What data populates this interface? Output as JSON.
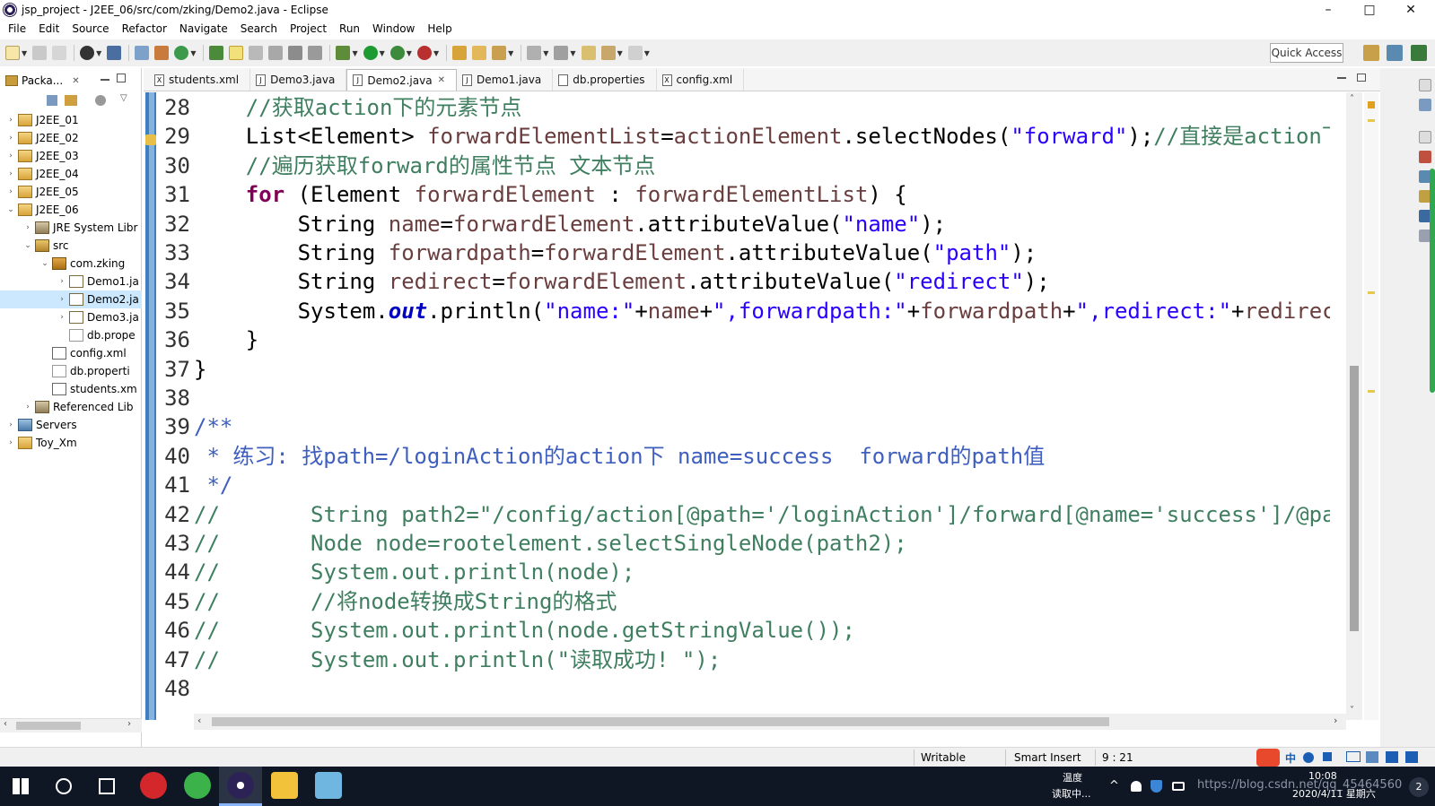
{
  "window": {
    "title": "jsp_project - J2EE_06/src/com/zking/Demo2.java - Eclipse",
    "minimize": "–",
    "maximize": "□",
    "close": "✕"
  },
  "menu": [
    "File",
    "Edit",
    "Source",
    "Refactor",
    "Navigate",
    "Search",
    "Project",
    "Run",
    "Window",
    "Help"
  ],
  "toolbar": {
    "quick_access": "Quick Access"
  },
  "explorer": {
    "tab_label": "Packa...",
    "tab_close": "✕",
    "tree": [
      {
        "label": "J2EE_01",
        "twisty": "›",
        "icon": "project",
        "indent": 0
      },
      {
        "label": "J2EE_02",
        "twisty": "›",
        "icon": "project",
        "indent": 0
      },
      {
        "label": "J2EE_03",
        "twisty": "›",
        "icon": "project",
        "indent": 0
      },
      {
        "label": "J2EE_04",
        "twisty": "›",
        "icon": "project",
        "indent": 0
      },
      {
        "label": "J2EE_05",
        "twisty": "›",
        "icon": "project",
        "indent": 0
      },
      {
        "label": "J2EE_06",
        "twisty": "⌄",
        "icon": "project",
        "indent": 0
      },
      {
        "label": "JRE System Libr",
        "twisty": "›",
        "icon": "library",
        "indent": 1
      },
      {
        "label": "src",
        "twisty": "⌄",
        "icon": "source-folder",
        "indent": 1
      },
      {
        "label": "com.zking",
        "twisty": "⌄",
        "icon": "package",
        "indent": 2
      },
      {
        "label": "Demo1.ja",
        "twisty": "›",
        "icon": "java-file",
        "indent": 3
      },
      {
        "label": "Demo2.ja",
        "twisty": "›",
        "icon": "java-file",
        "indent": 3,
        "selected": true
      },
      {
        "label": "Demo3.ja",
        "twisty": "›",
        "icon": "java-file",
        "indent": 3
      },
      {
        "label": "db.prope",
        "twisty": "",
        "icon": "file",
        "indent": 3
      },
      {
        "label": "config.xml",
        "twisty": "",
        "icon": "xml-file",
        "indent": 2
      },
      {
        "label": "db.properti",
        "twisty": "",
        "icon": "file",
        "indent": 2
      },
      {
        "label": "students.xm",
        "twisty": "",
        "icon": "xml-file",
        "indent": 2
      },
      {
        "label": "Referenced Lib",
        "twisty": "›",
        "icon": "library",
        "indent": 1
      },
      {
        "label": "Servers",
        "twisty": "›",
        "icon": "server",
        "indent": 0
      },
      {
        "label": "Toy_Xm",
        "twisty": "›",
        "icon": "project",
        "indent": 0
      }
    ]
  },
  "editor": {
    "tabs": [
      {
        "label": "students.xml",
        "icon": "X",
        "active": false
      },
      {
        "label": "Demo3.java",
        "icon": "J",
        "active": false
      },
      {
        "label": "Demo2.java",
        "icon": "J",
        "active": true,
        "close": "✕"
      },
      {
        "label": "Demo1.java",
        "icon": "J",
        "active": false
      },
      {
        "label": "db.properties",
        "icon": "",
        "active": false
      },
      {
        "label": "config.xml",
        "icon": "X",
        "active": false
      }
    ],
    "lines": [
      {
        "no": "28",
        "tokens": [
          [
            "cm",
            "    //获取action下的元素节点"
          ]
        ]
      },
      {
        "no": "29",
        "tokens": [
          [
            "",
            "    List<Element> "
          ],
          [
            "var",
            "forwardElementList"
          ],
          [
            "",
            "="
          ],
          [
            "var",
            "actionElement"
          ],
          [
            "",
            ".selectNodes("
          ],
          [
            "st",
            "\"forward\""
          ],
          [
            "",
            ");"
          ],
          [
            "cm",
            "//直接是action下"
          ]
        ]
      },
      {
        "no": "30",
        "tokens": [
          [
            "cm",
            "    //遍历获取forward的属性节点 文本节点"
          ]
        ]
      },
      {
        "no": "31",
        "tokens": [
          [
            "kw",
            "    for"
          ],
          [
            "",
            " (Element "
          ],
          [
            "var",
            "forwardElement"
          ],
          [
            "",
            " : "
          ],
          [
            "var",
            "forwardElementList"
          ],
          [
            "",
            ") {"
          ]
        ]
      },
      {
        "no": "32",
        "tokens": [
          [
            "",
            "        String "
          ],
          [
            "var",
            "name"
          ],
          [
            "",
            "="
          ],
          [
            "var",
            "forwardElement"
          ],
          [
            "",
            ".attributeValue("
          ],
          [
            "st",
            "\"name\""
          ],
          [
            "",
            ");"
          ]
        ]
      },
      {
        "no": "33",
        "tokens": [
          [
            "",
            "        String "
          ],
          [
            "var",
            "forwardpath"
          ],
          [
            "",
            "="
          ],
          [
            "var",
            "forwardElement"
          ],
          [
            "",
            ".attributeValue("
          ],
          [
            "st",
            "\"path\""
          ],
          [
            "",
            ");"
          ]
        ]
      },
      {
        "no": "34",
        "tokens": [
          [
            "",
            "        String "
          ],
          [
            "var",
            "redirect"
          ],
          [
            "",
            "="
          ],
          [
            "var",
            "forwardElement"
          ],
          [
            "",
            ".attributeValue("
          ],
          [
            "st",
            "\"redirect\""
          ],
          [
            "",
            ");"
          ]
        ]
      },
      {
        "no": "35",
        "tokens": [
          [
            "",
            "        System."
          ],
          [
            "fld",
            "out"
          ],
          [
            "",
            ".println("
          ],
          [
            "st",
            "\"name:\""
          ],
          [
            "",
            "+"
          ],
          [
            "var",
            "name"
          ],
          [
            "",
            "+"
          ],
          [
            "st",
            "\",forwardpath:\""
          ],
          [
            "",
            "+"
          ],
          [
            "var",
            "forwardpath"
          ],
          [
            "",
            "+"
          ],
          [
            "st",
            "\",redirect:\""
          ],
          [
            "",
            "+"
          ],
          [
            "var",
            "redirect"
          ]
        ]
      },
      {
        "no": "36",
        "tokens": [
          [
            "",
            "    }"
          ]
        ]
      },
      {
        "no": "37",
        "tokens": [
          [
            "",
            "}"
          ]
        ]
      },
      {
        "no": "38",
        "tokens": [
          [
            "",
            ""
          ]
        ]
      },
      {
        "no": "39",
        "tokens": [
          [
            "jd",
            "/**"
          ]
        ]
      },
      {
        "no": "40",
        "tokens": [
          [
            "jd",
            " * 练习: 找path=/loginAction的action下 name=success  forward的path值"
          ]
        ]
      },
      {
        "no": "41",
        "tokens": [
          [
            "jd",
            " */"
          ]
        ]
      },
      {
        "no": "42",
        "tokens": [
          [
            "cm",
            "//       String path2=\"/config/action[@path='/loginAction']/forward[@name='success']/@pa"
          ]
        ]
      },
      {
        "no": "43",
        "tokens": [
          [
            "cm",
            "//       Node node=rootelement.selectSingleNode(path2);"
          ]
        ]
      },
      {
        "no": "44",
        "tokens": [
          [
            "cm",
            "//       System.out.println(node);"
          ]
        ]
      },
      {
        "no": "45",
        "tokens": [
          [
            "cm",
            "//       //将node转换成String的格式"
          ]
        ]
      },
      {
        "no": "46",
        "tokens": [
          [
            "cm",
            "//       System.out.println(node.getStringValue());"
          ]
        ]
      },
      {
        "no": "47",
        "tokens": [
          [
            "cm",
            "//       System.out.println(\"读取成功! \");"
          ]
        ]
      },
      {
        "no": "48",
        "tokens": [
          [
            "",
            ""
          ]
        ]
      }
    ]
  },
  "status": {
    "writable": "Writable",
    "insert_mode": "Smart Insert",
    "cursor": "9 : 21"
  },
  "taskbar": {
    "weather_label": "温度",
    "weather_status": "读取中...",
    "time": "10:08",
    "date": "2020/4/11 星期六",
    "ime_lang": "中",
    "notification_count": "2",
    "watermark": "https://blog.csdn.net/qq_45464560"
  },
  "colors": {
    "keyword": "#7f0055",
    "comment": "#3f7f5f",
    "javadoc": "#3f5fbf",
    "string": "#2a00ff",
    "variable": "#6a3e3e",
    "field": "#0000c0"
  }
}
